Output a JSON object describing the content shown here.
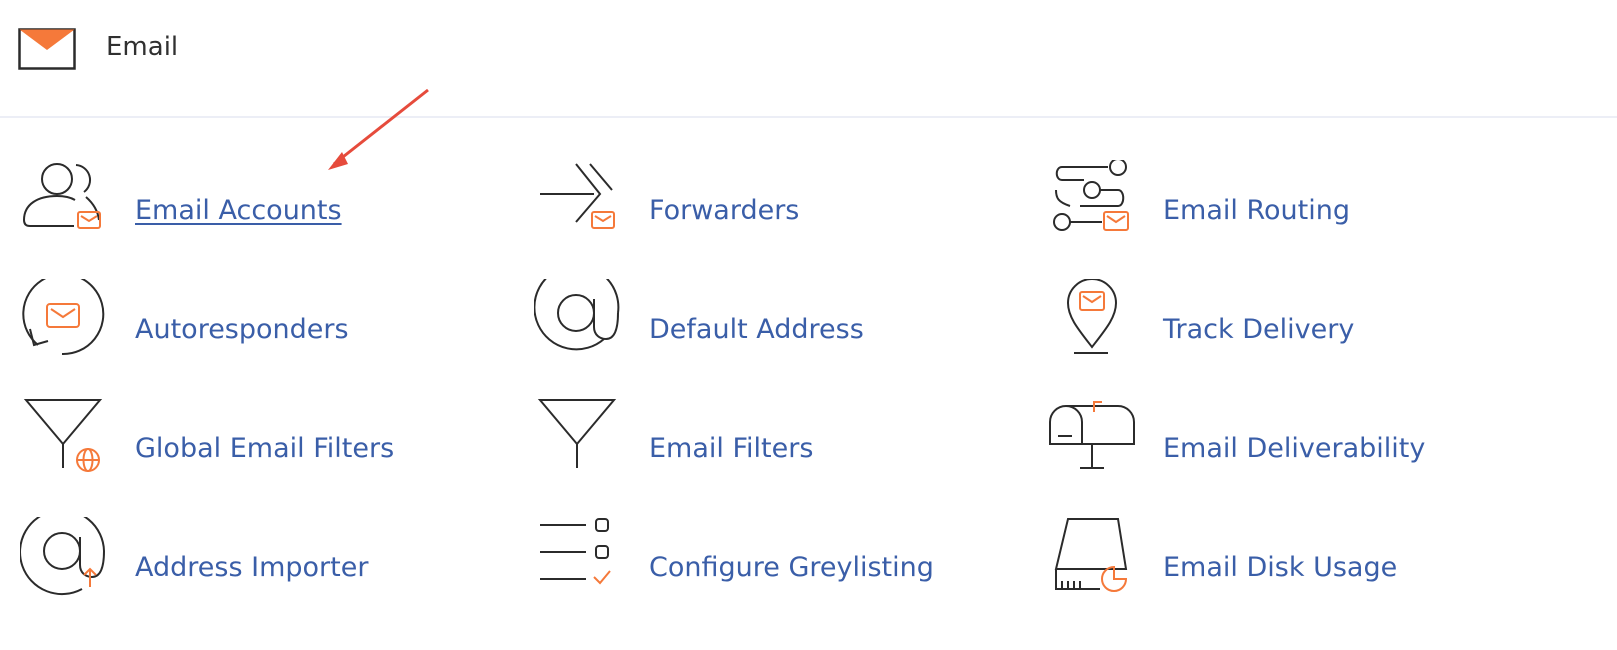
{
  "header": {
    "title": "Email"
  },
  "colors": {
    "accent": "#f5793a",
    "link": "#3a5ea8",
    "icon_stroke": "#2b2b2b",
    "annotation_arrow": "#e64b3c"
  },
  "items": [
    {
      "label": "Email Accounts",
      "icon": "user-envelope-icon",
      "active": true
    },
    {
      "label": "Forwarders",
      "icon": "forward-arrow-envelope-icon"
    },
    {
      "label": "Email Routing",
      "icon": "routing-icon"
    },
    {
      "label": "Autoresponders",
      "icon": "autoresponder-cycle-icon"
    },
    {
      "label": "Default Address",
      "icon": "at-sign-icon"
    },
    {
      "label": "Track Delivery",
      "icon": "map-pin-envelope-icon"
    },
    {
      "label": "Global Email Filters",
      "icon": "filter-globe-icon"
    },
    {
      "label": "Email Filters",
      "icon": "filter-funnel-icon"
    },
    {
      "label": "Email Deliverability",
      "icon": "mailbox-icon"
    },
    {
      "label": "Address Importer",
      "icon": "at-sign-import-icon"
    },
    {
      "label": "Configure Greylisting",
      "icon": "checklist-icon"
    },
    {
      "label": "Email Disk Usage",
      "icon": "disk-usage-pie-icon"
    }
  ]
}
